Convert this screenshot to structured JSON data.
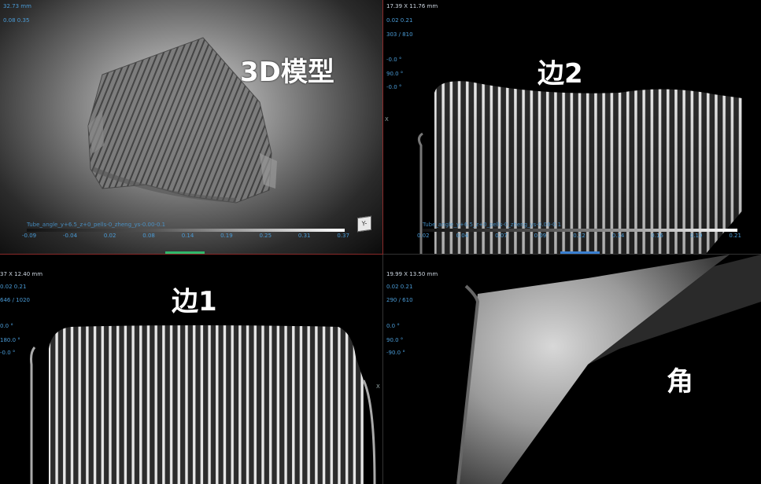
{
  "pane_3d": {
    "dims_text": "32.73 mm",
    "values_text": "0.08     0.35",
    "label": "3D模型",
    "tube_text": "Tube_angle_y+6.5_z+0_pells-0_zheng_ys-0.00-0.1",
    "ticks": [
      "-0.09",
      "-0.04",
      "0.02",
      "0.08",
      "0.14",
      "0.19",
      "0.25",
      "0.31",
      "0.37"
    ],
    "cube_text": "Y-"
  },
  "pane_edge2": {
    "dims_text": "17.39 X 11.76 mm",
    "values_text": "0.02     0.21",
    "slice_text": "303 / 810",
    "angles": [
      "-0.0 °",
      "90.0 °",
      "-0.0 °"
    ],
    "label": "边2",
    "tube_text": "Tube_angle_y+6.5_z+0_pells-0_zheng_ys-0.00-0.1",
    "ticks": [
      "0.02",
      "0.04",
      "0.07",
      "0.09",
      "0.12",
      "0.14",
      "0.16",
      "0.19",
      "0.21"
    ],
    "axis_letter": "X"
  },
  "pane_edge1": {
    "dims_text": "37 X 12.40 mm",
    "values_text": "0.02     0.21",
    "slice_text": "646 / 1020",
    "angles": [
      "0.0 °",
      "180.0 °",
      "-0.0 °"
    ],
    "label": "边1",
    "axis_letter": "X"
  },
  "pane_corner": {
    "dims_text": "19.99 X 13.50 mm",
    "values_text": "0.02     0.21",
    "slice_text": "290 / 610",
    "angles": [
      "0.0 °",
      "90.0 °",
      "-90.0 °"
    ],
    "label": "角"
  }
}
